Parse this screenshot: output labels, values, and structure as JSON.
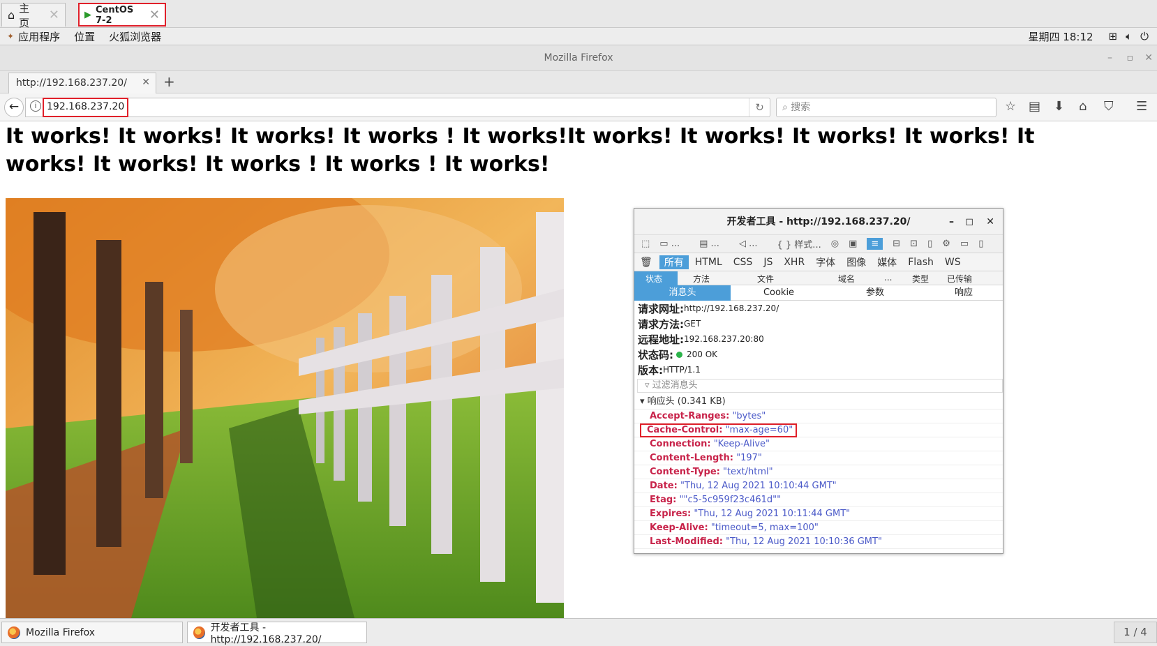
{
  "vm_tabs": [
    {
      "label": "主页"
    },
    {
      "label": "CentOS 7-2"
    }
  ],
  "gnome": {
    "menus": [
      "应用程序",
      "位置",
      "火狐浏览器"
    ],
    "clock": "星期四 18:12"
  },
  "firefox": {
    "window_title": "Mozilla Firefox",
    "tab_title": "http://192.168.237.20/",
    "url": "192.168.237.20",
    "search_placeholder": "搜索"
  },
  "page": {
    "heading": "It works! It works! It works! It works ! It works!It works! It works! It works! It works! It works! It works! It works ! It works ! It works!"
  },
  "devtools": {
    "title": "开发者工具 - http://192.168.237.20/",
    "toolbar_items": [
      "...",
      "...",
      "...",
      "{ } 样式..."
    ],
    "filters": [
      "所有",
      "HTML",
      "CSS",
      "JS",
      "XHR",
      "字体",
      "图像",
      "媒体",
      "Flash",
      "WS"
    ],
    "columns": [
      "状态",
      "方法",
      "文件",
      "域名",
      "...",
      "类型",
      "已传输"
    ],
    "subtabs": [
      "消息头",
      "Cookie",
      "参数",
      "响应"
    ],
    "summary": [
      {
        "label": "请求网址:",
        "value": "http://192.168.237.20/"
      },
      {
        "label": "请求方法:",
        "value": "GET"
      },
      {
        "label": "远程地址:",
        "value": "192.168.237.20:80"
      },
      {
        "label": "状态码:",
        "value": "200 OK"
      },
      {
        "label": "版本:",
        "value": "HTTP/1.1"
      }
    ],
    "filter_placeholder": "过滤消息头",
    "section_title": "响应头 (0.341 KB)",
    "headers": [
      {
        "name": "Accept-Ranges:",
        "value": "\"bytes\""
      },
      {
        "name": "Cache-Control:",
        "value": "\"max-age=60\""
      },
      {
        "name": "Connection:",
        "value": "\"Keep-Alive\""
      },
      {
        "name": "Content-Length:",
        "value": "\"197\""
      },
      {
        "name": "Content-Type:",
        "value": "\"text/html\""
      },
      {
        "name": "Date:",
        "value": "\"Thu, 12 Aug 2021 10:10:44 GMT\""
      },
      {
        "name": "Etag:",
        "value": "\"\"c5-5c959f23c461d\"\""
      },
      {
        "name": "Expires:",
        "value": "\"Thu, 12 Aug 2021 10:11:44 GMT\""
      },
      {
        "name": "Keep-Alive:",
        "value": "\"timeout=5, max=100\""
      },
      {
        "name": "Last-Modified:",
        "value": "\"Thu, 12 Aug 2021 10:10:36 GMT\""
      }
    ]
  },
  "taskbar": {
    "items": [
      "Mozilla Firefox",
      "开发者工具 - http://192.168.237.20/"
    ],
    "pager": "1 / 4"
  }
}
